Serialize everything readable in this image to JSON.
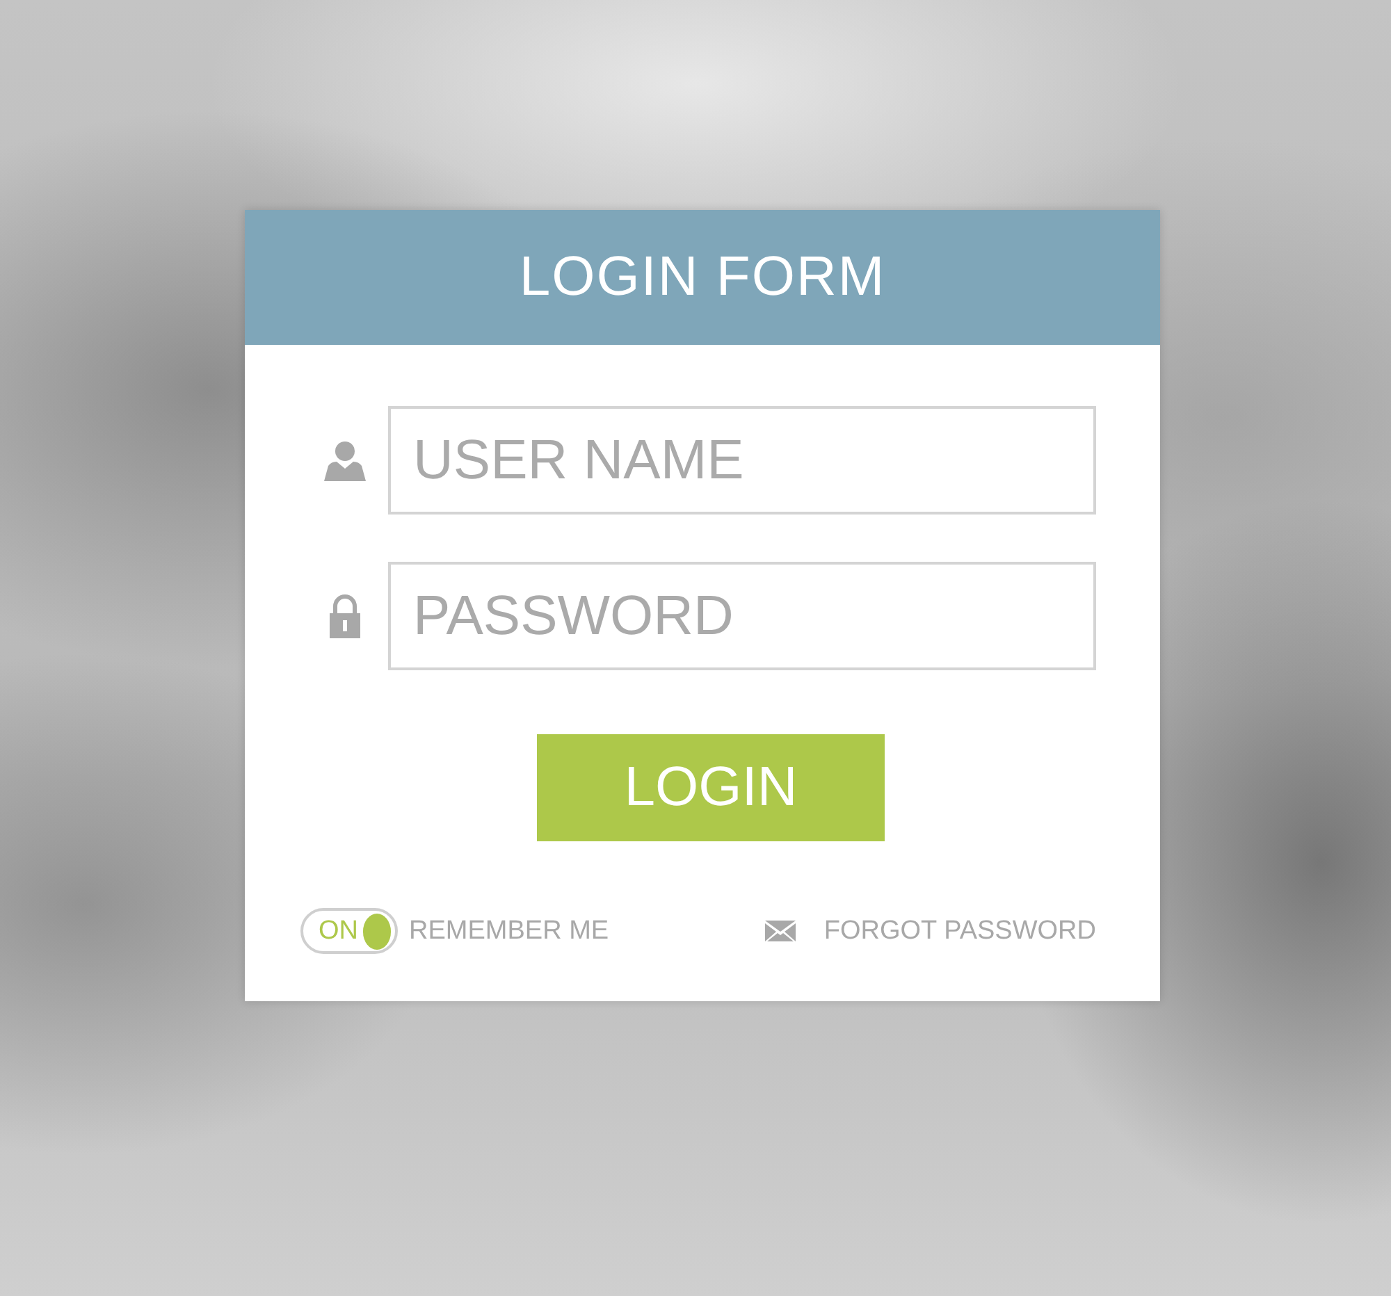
{
  "title": "LOGIN FORM",
  "fields": [
    {
      "kind": "user",
      "placeholder": "USER NAME"
    },
    {
      "kind": "password",
      "placeholder": "PASSWORD"
    }
  ],
  "login_button": "LOGIN",
  "remember": {
    "toggle_label": "ON",
    "on": true,
    "label": "REMEMBER ME"
  },
  "forgot_link": "FORGOT PASSWORD"
}
